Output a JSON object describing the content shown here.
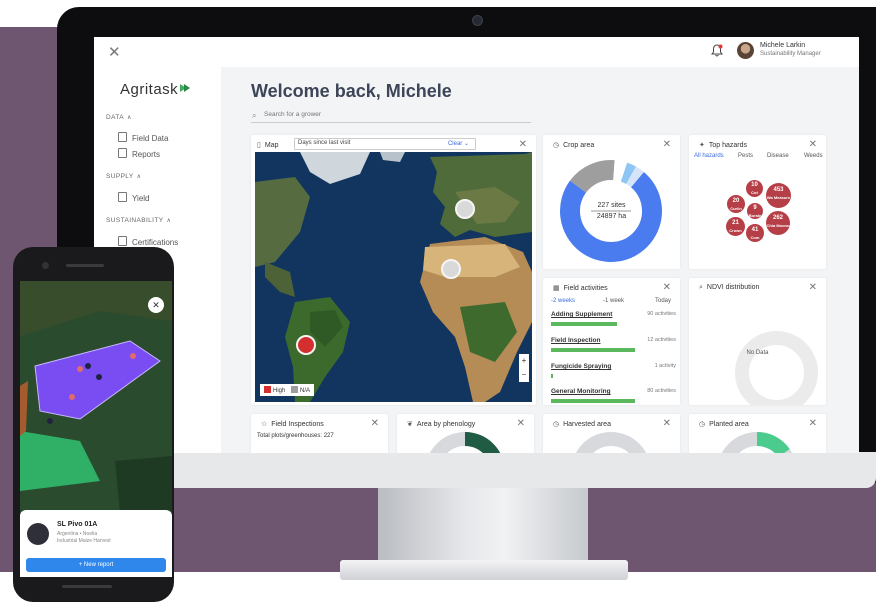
{
  "app": {
    "logo_text": "Agritask",
    "user_name": "Michele Larkin",
    "user_role": "Sustainability Manager",
    "welcome": "Welcome back, Michele"
  },
  "search": {
    "placeholder": "Search for a grower"
  },
  "sidebar": {
    "sections": [
      {
        "label": "DATA",
        "items": [
          "Field Data",
          "Reports"
        ]
      },
      {
        "label": "SUPPLY",
        "items": [
          "Yield"
        ]
      },
      {
        "label": "SUSTAINABILITY",
        "items": [
          "Certifications"
        ]
      }
    ]
  },
  "map_card": {
    "title": "Map",
    "dropdown_value": "Days since last visit",
    "clear_label": "Clear",
    "legend": [
      {
        "label": "High",
        "color": "#d32f2f"
      },
      {
        "label": "N/A",
        "color": "#9e9e9e"
      }
    ],
    "zoom_in": "+",
    "zoom_out": "−"
  },
  "crop_card": {
    "title": "Crop area",
    "center_line1": "227 sites",
    "center_line2": "24897 ha",
    "slices": [
      {
        "value": 0.74,
        "color": "#4a7cf0"
      },
      {
        "value": 0.16,
        "color": "#9e9e9e"
      },
      {
        "value": 0.04,
        "color": "#ffffff"
      },
      {
        "value": 0.03,
        "color": "#8ec5f5"
      },
      {
        "value": 0.03,
        "color": "#d6e4fa"
      }
    ]
  },
  "hazards_card": {
    "title": "Top hazards",
    "tabs": [
      "All hazards",
      "Pests",
      "Disease",
      "Weeds"
    ],
    "bubbles": [
      {
        "count": "453",
        "label": "Wa Measure"
      },
      {
        "count": "10",
        "label": "Cot"
      },
      {
        "count": "20",
        "label": "Curlin"
      },
      {
        "count": "9",
        "label": "Borale"
      },
      {
        "count": "262",
        "label": "Chia Moonu"
      },
      {
        "count": "21",
        "label": "Crown Con"
      },
      {
        "count": "41",
        "label": "Com"
      }
    ]
  },
  "field_activities": {
    "title": "Field activities",
    "tabs": [
      "-2 weeks",
      "-1 week",
      "Today"
    ],
    "items": [
      {
        "name": "Adding Supplement",
        "count": "90 activities",
        "fill": 0.69
      },
      {
        "name": "Field Inspection",
        "count": "12 activities",
        "fill": 0.88
      },
      {
        "name": "Fungicide Spraying",
        "count": "1 activity",
        "fill": 0.01
      },
      {
        "name": "General Monitoring",
        "count": "80 activities",
        "fill": 0.88
      }
    ]
  },
  "ndvi_card": {
    "title": "NDVI distribution",
    "empty_text": "No Data"
  },
  "field_inspections": {
    "title": "Field Inspections",
    "subtitle": "Total plots/greenhouses: 227"
  },
  "phenology": {
    "title": "Area by phenology"
  },
  "harvested": {
    "title": "Harvested area"
  },
  "planted": {
    "title": "Planted area"
  },
  "phone": {
    "site_name": "SL Pivo 01A",
    "line2": "Argentina • Noelia",
    "line3": "Industrial Maize Harvest",
    "button": "New report"
  }
}
